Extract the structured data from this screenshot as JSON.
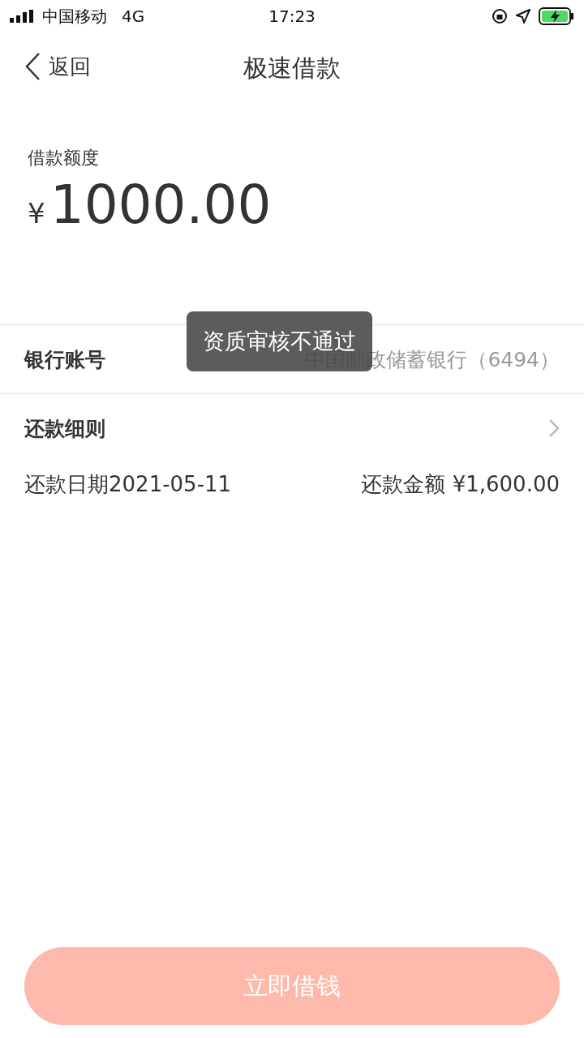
{
  "status_bar": {
    "carrier": "中国移动",
    "network": "4G",
    "time": "17:23"
  },
  "nav": {
    "back": "返回",
    "title": "极速借款"
  },
  "quota": {
    "label": "借款额度",
    "currency": "¥",
    "amount": "1000.00"
  },
  "bank": {
    "label": "银行账号",
    "value": "中国邮政储蓄银行（6494）"
  },
  "details": {
    "label": "还款细则",
    "date": "还款日期2021-05-11",
    "amount": "还款金额 ¥1,600.00"
  },
  "toast": "资质审核不通过",
  "submit": {
    "label": "立即借钱",
    "disabled": true
  }
}
